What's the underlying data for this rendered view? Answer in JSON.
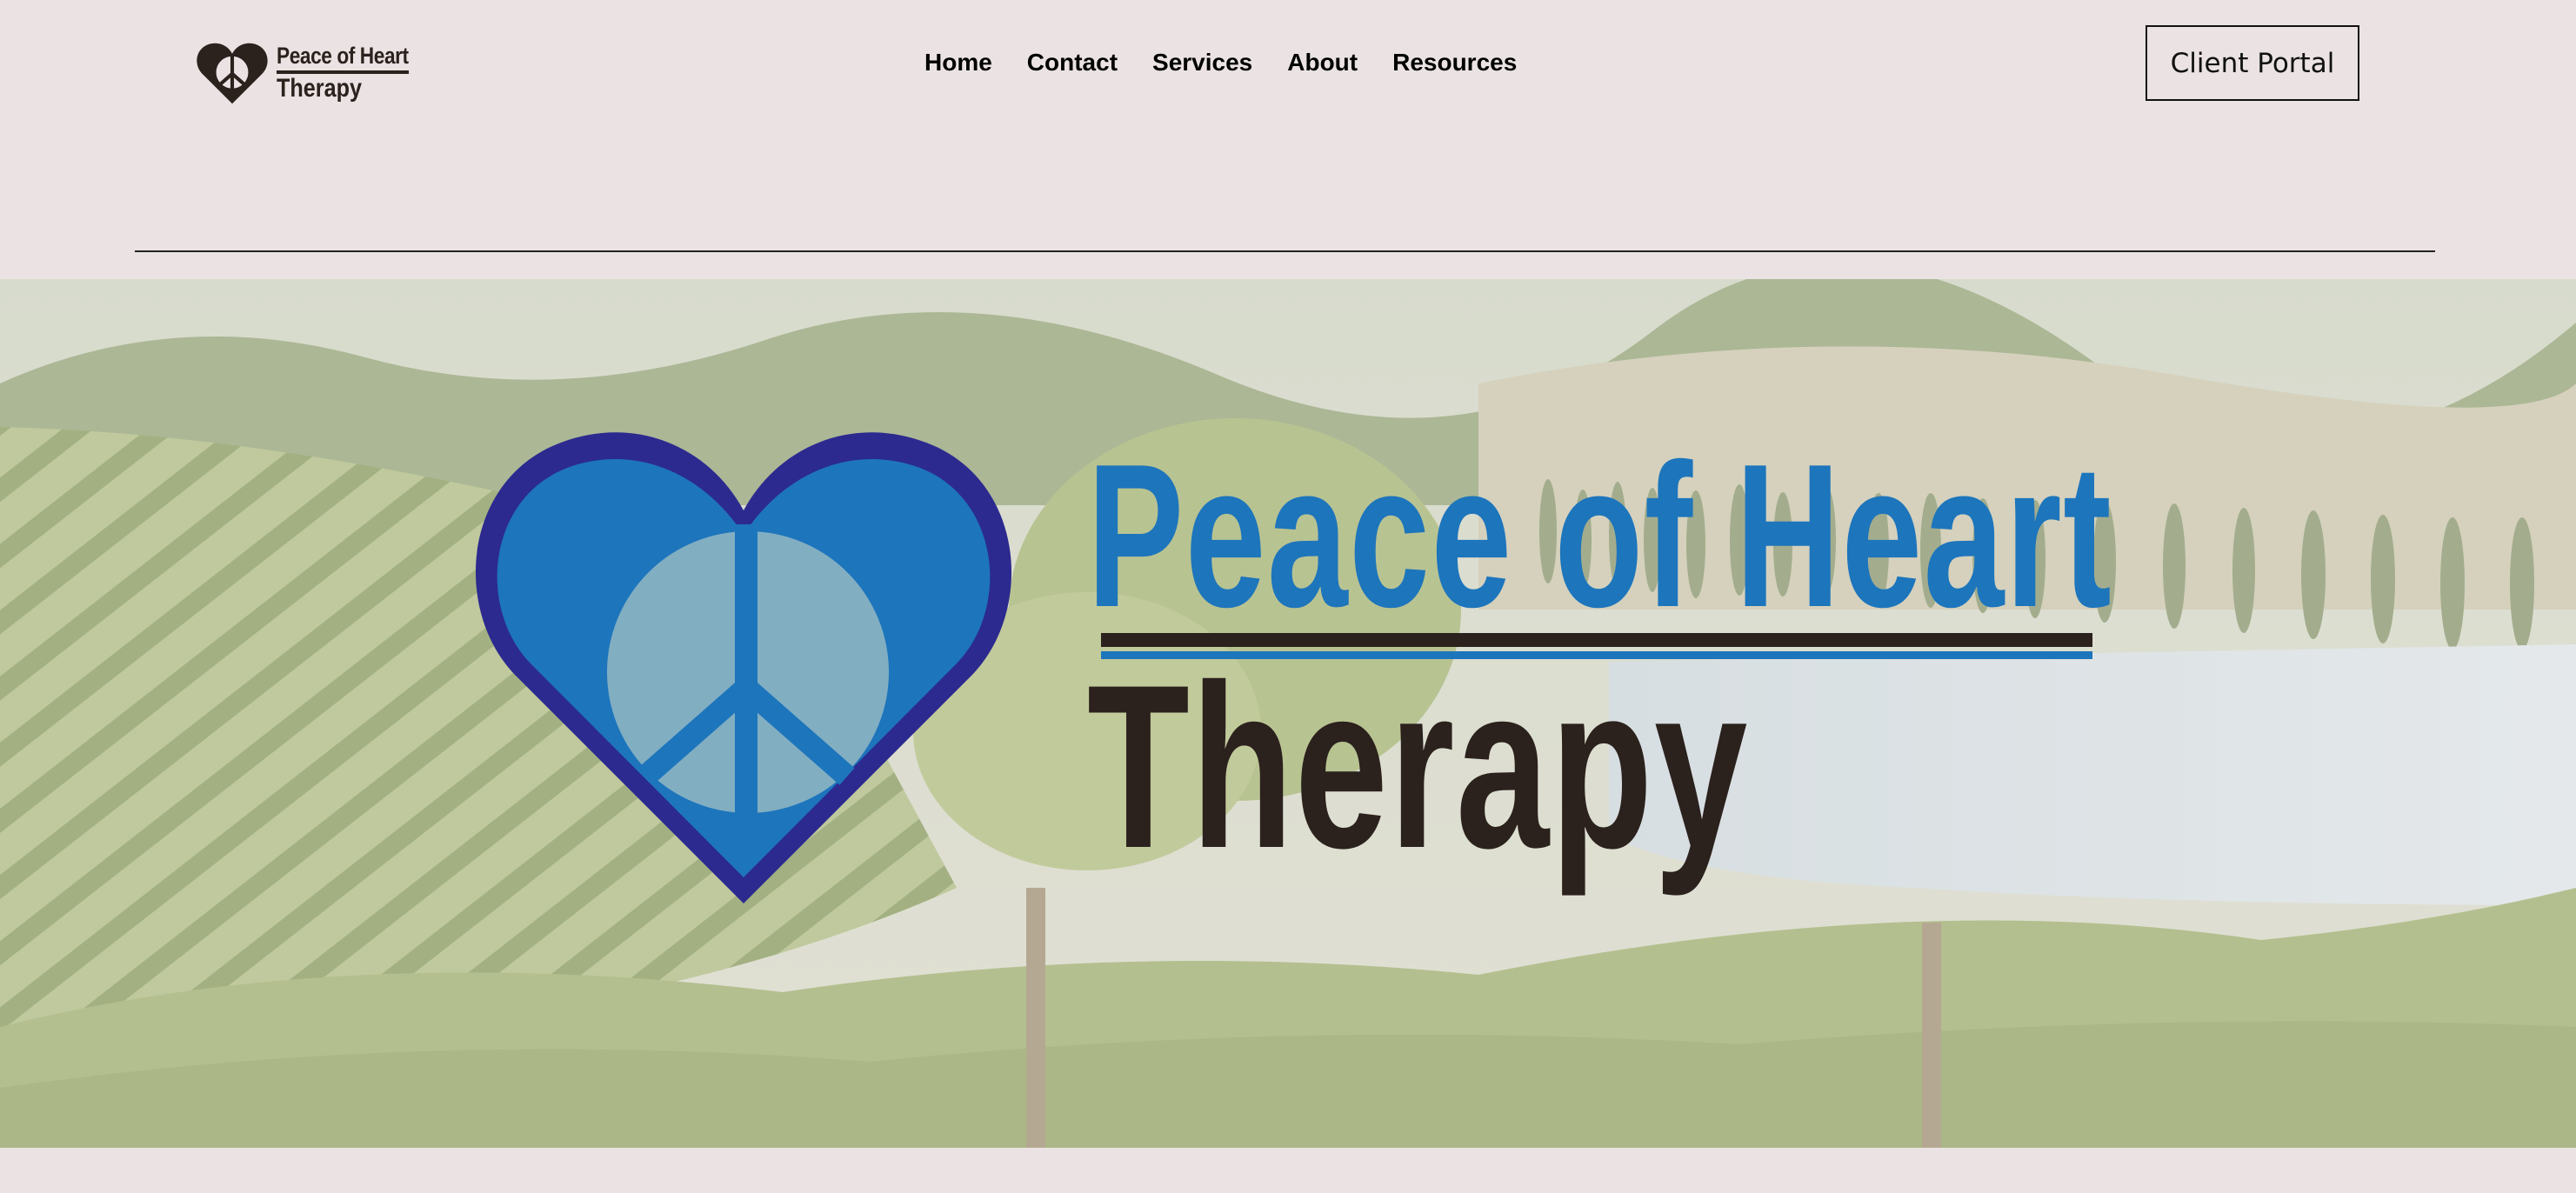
{
  "brand": {
    "line1": "Peace of Heart",
    "line2": "Therapy",
    "colors": {
      "blue": "#1d75bc",
      "navy": "#2c2a8f",
      "dark": "#2b211d"
    },
    "icon": "peace-heart-icon"
  },
  "nav": {
    "items": [
      {
        "label": "Home"
      },
      {
        "label": "Contact"
      },
      {
        "label": "Services"
      },
      {
        "label": "About"
      },
      {
        "label": "Resources"
      }
    ]
  },
  "header": {
    "client_portal_label": "Client Portal"
  },
  "hero": {
    "title_line1": "Peace of Heart",
    "title_line2": "Therapy",
    "background": "vineyard-landscape-photo"
  },
  "colors": {
    "page_bg": "#ebe3e3"
  }
}
